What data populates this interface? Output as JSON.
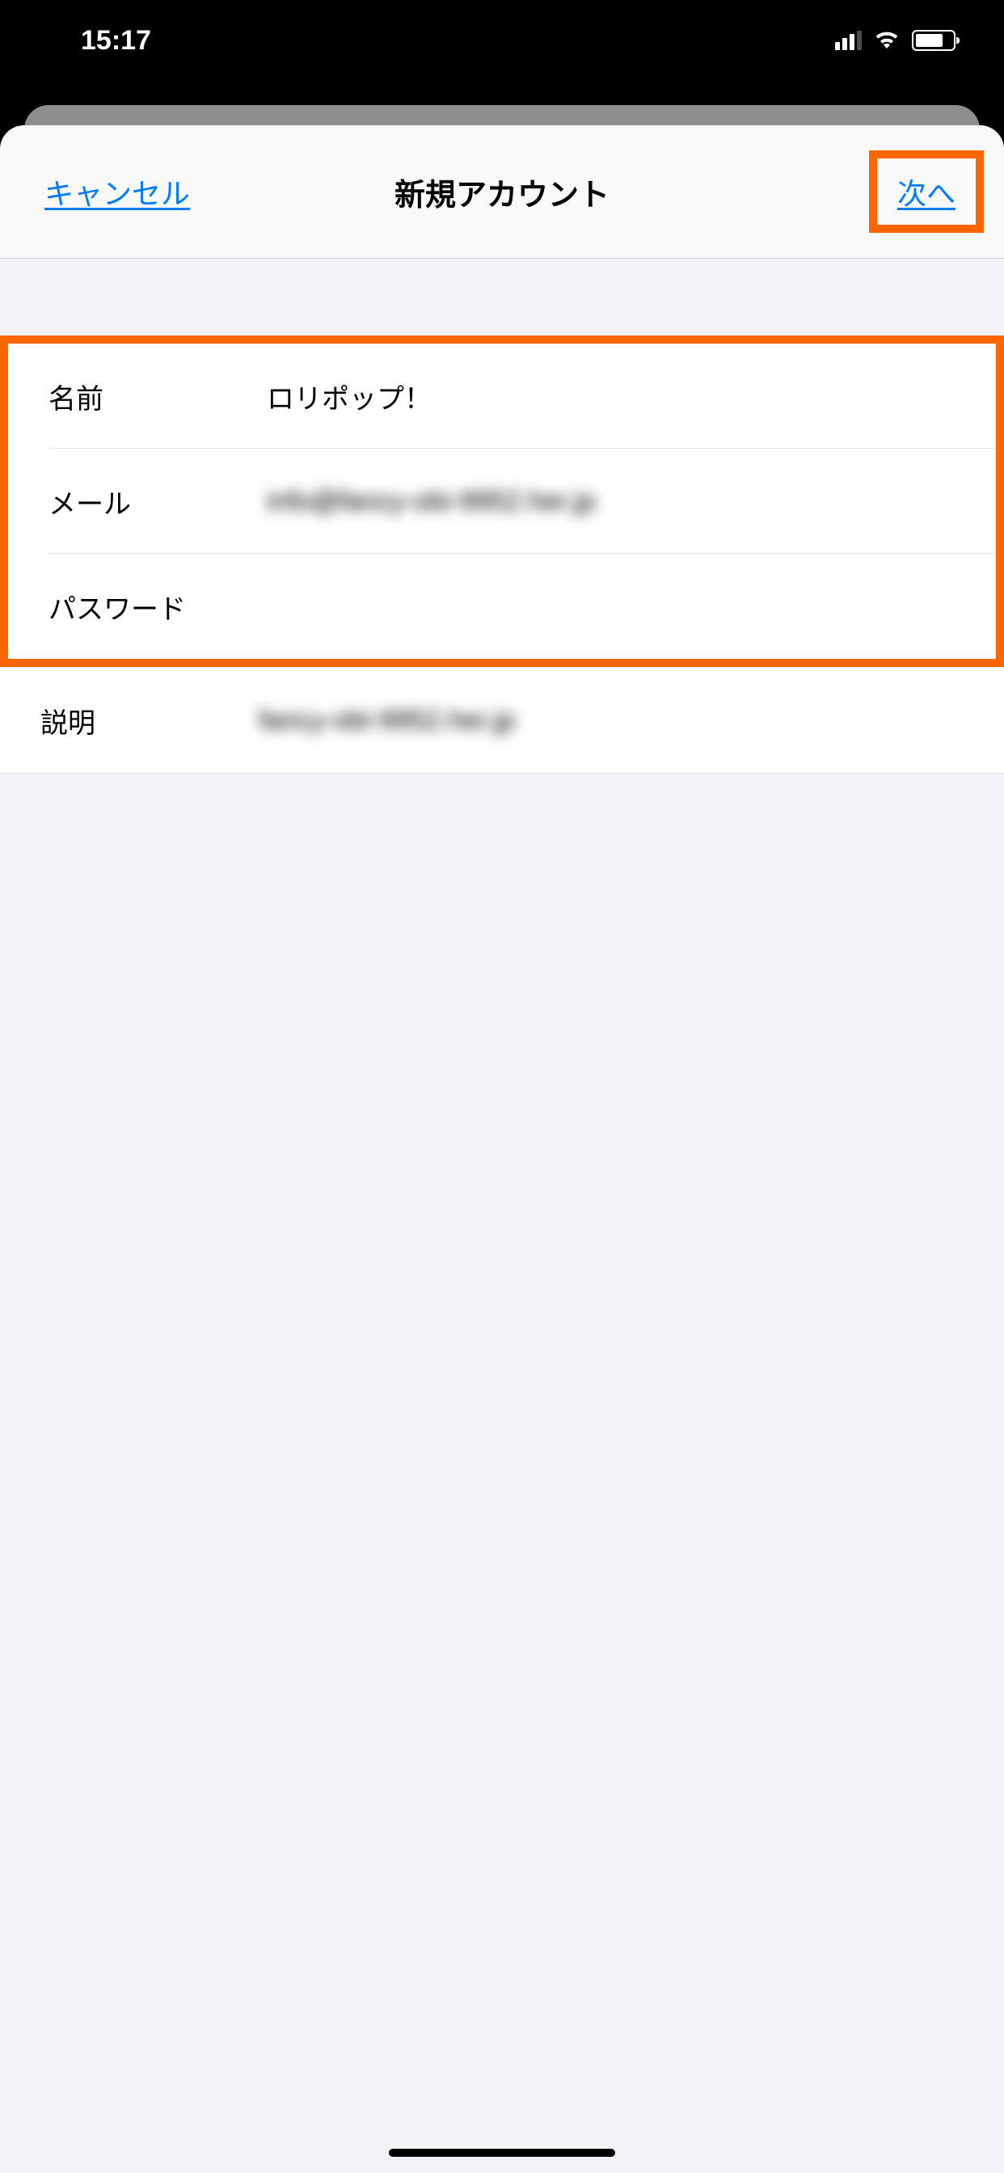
{
  "status_bar": {
    "time": "15:17"
  },
  "header": {
    "cancel_label": "キャンセル",
    "title": "新規アカウント",
    "next_label": "次へ"
  },
  "form": {
    "name_label": "名前",
    "name_value": "ロリポップ！",
    "mail_label": "メール",
    "mail_value": "info@fancy-obi-9952.her.jp",
    "password_label": "パスワード",
    "password_value": "",
    "description_label": "説明",
    "description_value": "fancy-obi-9952.her.jp"
  }
}
